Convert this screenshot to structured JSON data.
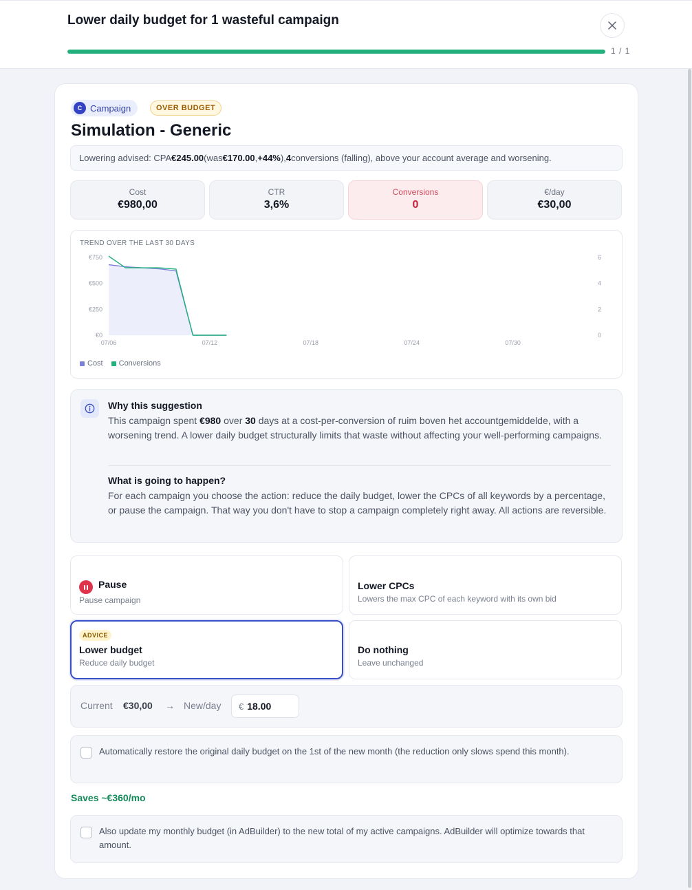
{
  "header": {
    "title": "Lower daily budget for 1 wasteful campaign",
    "progress_fraction": 1.0,
    "step_count": "1 / 1"
  },
  "badges": {
    "campaign_letter": "C",
    "campaign_label": "Campaign",
    "status": "OVER BUDGET"
  },
  "page_title": "Simulation - Generic",
  "advice": {
    "prefix": "Lowering advised: CPA ",
    "cpa": "€245.00",
    "was_prefix": " (was ",
    "was": "€170.00",
    "sep": ", ",
    "change": "+44%",
    "close": "), ",
    "conversions": "4",
    "suffix": " conversions (falling), above your account average and worsening."
  },
  "metrics": [
    {
      "label": "Cost",
      "value": "€980,00",
      "alert": false
    },
    {
      "label": "CTR",
      "value": "3,6%",
      "alert": false
    },
    {
      "label": "Conversions",
      "value": "0",
      "alert": true
    },
    {
      "label": "€/day",
      "value": "€30,00",
      "alert": false
    }
  ],
  "chart_heading": "TREND OVER THE LAST 30 DAYS",
  "chart_data": {
    "type": "area",
    "title": "TREND OVER THE LAST 30 DAYS",
    "x": [
      "07/06",
      "07/07",
      "07/08",
      "07/09",
      "07/10",
      "07/11",
      "07/12",
      "07/13",
      "07/14",
      "07/15",
      "07/16",
      "07/17",
      "07/18",
      "07/19",
      "07/20",
      "07/21",
      "07/22",
      "07/23",
      "07/24",
      "07/25",
      "07/26",
      "07/27",
      "07/28",
      "07/29",
      "07/30",
      "07/31",
      "08/01",
      "08/02",
      "08/03",
      "08/04"
    ],
    "x_tick_labels": [
      "07/06",
      "07/12",
      "07/18",
      "07/24",
      "07/30"
    ],
    "y_left": {
      "ylim": [
        0,
        750
      ],
      "ticks": [
        "€0",
        "€250",
        "€500",
        "€750"
      ]
    },
    "y_right": {
      "ylim": [
        0,
        6
      ],
      "ticks": [
        "0",
        "2",
        "4",
        "6"
      ]
    },
    "series": [
      {
        "name": "Cost",
        "axis": "left",
        "color": "#7b80d9",
        "fill": "#eceefb",
        "values": [
          680,
          660,
          650,
          640,
          620,
          0,
          0,
          0,
          null,
          null,
          null,
          null,
          null,
          null,
          null,
          null,
          null,
          null,
          null,
          null,
          null,
          null,
          null,
          null,
          null,
          null,
          null,
          null,
          null,
          null
        ]
      },
      {
        "name": "Conversions",
        "axis": "right",
        "color": "#22b07d",
        "values": [
          6.1,
          5.2,
          5.2,
          5.2,
          5.1,
          0,
          0,
          0,
          null,
          null,
          null,
          null,
          null,
          null,
          null,
          null,
          null,
          null,
          null,
          null,
          null,
          null,
          null,
          null,
          null,
          null,
          null,
          null,
          null,
          null
        ]
      }
    ],
    "legend": [
      "Cost",
      "Conversions"
    ],
    "legend_position": "bottom-left",
    "grid": false
  },
  "why": {
    "title": "Why this suggestion",
    "p1": "This campaign spent ",
    "spent": "€980",
    "p2": " over ",
    "days": "30",
    "p3": " days at a cost-per-conversion of ruim boven het accountgemiddelde, with a worsening trend. A lower daily budget structurally limits that waste without affecting your well-performing campaigns.",
    "what_title": "What is going to happen?",
    "what_text": "For each campaign you choose the action: reduce the daily budget, lower the CPCs of all keywords by a percentage, or pause the campaign. That way you don't have to stop a campaign completely right away. All actions are reversible."
  },
  "options": {
    "pause": {
      "title": "Pause",
      "sub": "Pause campaign"
    },
    "lower_cpcs": {
      "title": "Lower CPCs",
      "sub": "Lowers the max CPC of each keyword with its own bid"
    },
    "lower_budget": {
      "badge": "ADVICE",
      "title": "Lower budget",
      "sub": "Reduce daily budget",
      "selected": true
    },
    "do_nothing": {
      "title": "Do nothing",
      "sub": "Leave unchanged"
    }
  },
  "budget": {
    "current_label": "Current",
    "current_value": "€30,00",
    "arrow": "→",
    "new_label": "New/day",
    "currency": "€",
    "new_value": "18.00"
  },
  "auto_restore": {
    "checked": false,
    "text": "Automatically restore the original daily budget on the 1st of the new month (the reduction only slows spend this month)."
  },
  "saves": "Saves ~€360/mo",
  "update_monthly": {
    "checked": false,
    "text": "Also update my monthly budget (in AdBuilder) to the new total of my active campaigns. AdBuilder will optimize towards that amount."
  },
  "colors": {
    "accent": "#3a4fc4",
    "progress": "#22b07d",
    "alert": "#c8203b",
    "saves": "#138a5a"
  }
}
